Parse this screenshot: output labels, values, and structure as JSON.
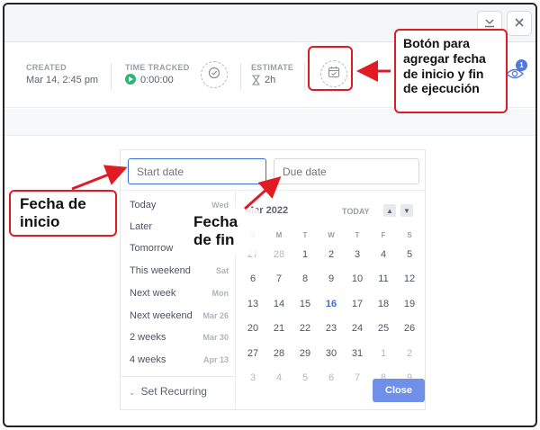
{
  "topbar": {
    "download_icon": "download-icon",
    "close_icon": "close-icon"
  },
  "info": {
    "created_label": "CREATED",
    "created_value": "Mar 14, 2:45 pm",
    "time_tracked_label": "TIME TRACKED",
    "time_tracked_value": "0:00:00",
    "estimate_label": "ESTIMATE",
    "estimate_value": "2h",
    "watchers_badge": "1"
  },
  "picker": {
    "start_placeholder": "Start date",
    "due_placeholder": "Due date",
    "quick_options": [
      {
        "label": "Today",
        "hint": "Wed"
      },
      {
        "label": "Later",
        "hint": ""
      },
      {
        "label": "Tomorrow",
        "hint": ""
      },
      {
        "label": "This weekend",
        "hint": "Sat"
      },
      {
        "label": "Next week",
        "hint": "Mon"
      },
      {
        "label": "Next weekend",
        "hint": "Mar 26"
      },
      {
        "label": "2 weeks",
        "hint": "Mar 30"
      },
      {
        "label": "4 weeks",
        "hint": "Apr 13"
      }
    ],
    "set_recurring": "Set Recurring",
    "month_label": "Mar 2022",
    "today_button": "TODAY",
    "weekdays": [
      "S",
      "M",
      "T",
      "W",
      "T",
      "F",
      "S"
    ],
    "weeks": [
      [
        "27",
        "28",
        "1",
        "2",
        "3",
        "4",
        "5"
      ],
      [
        "6",
        "7",
        "8",
        "9",
        "10",
        "11",
        "12"
      ],
      [
        "13",
        "14",
        "15",
        "16",
        "17",
        "18",
        "19"
      ],
      [
        "20",
        "21",
        "22",
        "23",
        "24",
        "25",
        "26"
      ],
      [
        "27",
        "28",
        "29",
        "30",
        "31",
        "1",
        "2"
      ],
      [
        "3",
        "4",
        "5",
        "6",
        "7",
        "8",
        "9"
      ]
    ],
    "close_button": "Close"
  },
  "callouts": {
    "button_note": "Botón para agregar fecha de inicio y fin de ejecución",
    "start_note": "Fecha de inicio",
    "end_note": "Fecha de fin"
  },
  "colors": {
    "accent": "#3b6fd8",
    "callout_red": "#e01b24",
    "play_green": "#2bb673"
  }
}
